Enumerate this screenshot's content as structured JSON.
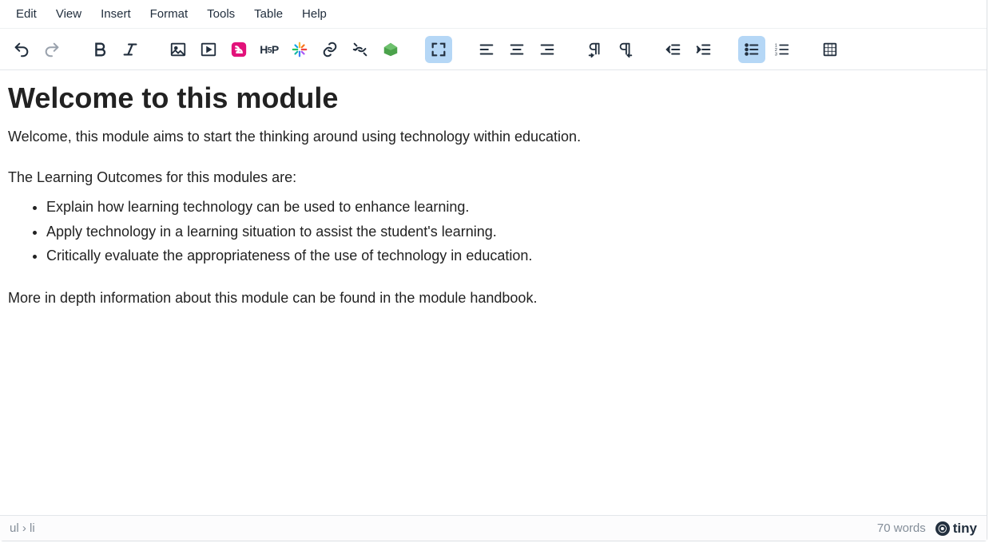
{
  "menubar": {
    "items": [
      {
        "label": "Edit"
      },
      {
        "label": "View"
      },
      {
        "label": "Insert"
      },
      {
        "label": "Format"
      },
      {
        "label": "Tools"
      },
      {
        "label": "Table"
      },
      {
        "label": "Help"
      }
    ]
  },
  "toolbar": {
    "icons": {
      "undo": "undo-icon",
      "redo": "redo-icon",
      "bold": "bold-icon",
      "italic": "italic-icon",
      "image": "image-icon",
      "media": "media-icon",
      "e_app": "e-app-icon",
      "h5p": "h5p-icon",
      "sparkle": "sparkle-icon",
      "link": "link-icon",
      "unlink": "unlink-icon",
      "shape": "shape-icon",
      "fullscreen": "fullscreen-icon",
      "align_left": "align-left-icon",
      "align_center": "align-center-icon",
      "align_right": "align-right-icon",
      "ltr": "ltr-icon",
      "rtl": "rtl-icon",
      "outdent": "outdent-icon",
      "indent": "indent-icon",
      "bullet_list": "bullet-list-icon",
      "number_list": "number-list-icon",
      "table_grid": "table-grid-icon"
    },
    "h5p_label": "H·P"
  },
  "content": {
    "heading": "Welcome to this module",
    "p1": "Welcome, this module aims to start the thinking around using technology within education.",
    "p2": "The Learning Outcomes for this modules are:",
    "list": [
      "Explain how learning technology can be used to enhance learning.",
      "Apply technology in a learning situation to assist the student's learning.",
      "Critically evaluate the appropriateness of the use of technology in education."
    ],
    "p3": "More in depth information about this module can be found in the module handbook."
  },
  "statusbar": {
    "path": "ul › li",
    "wordcount": "70 words",
    "brand": "tiny"
  }
}
